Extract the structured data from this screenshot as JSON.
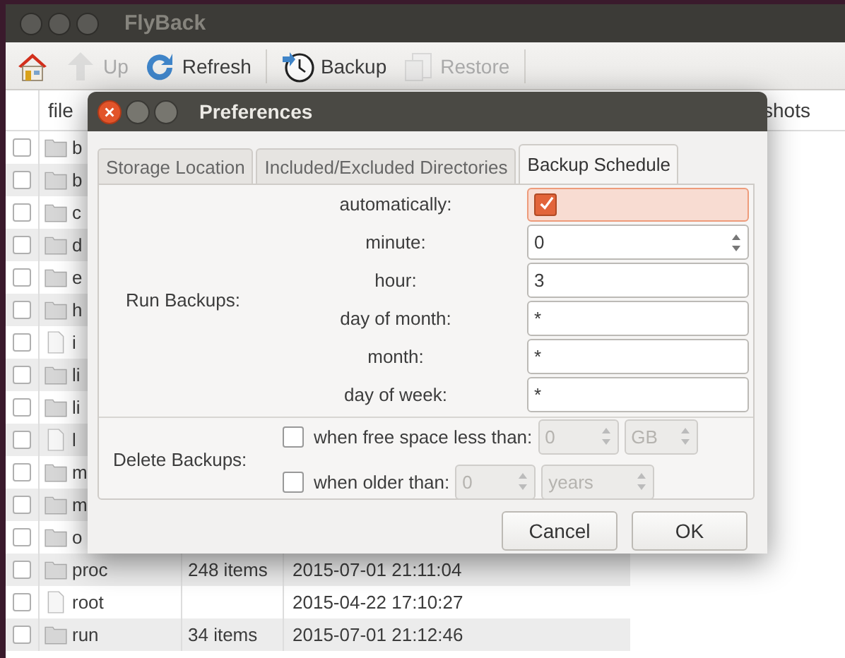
{
  "main_window": {
    "title": "FlyBack",
    "toolbar_groups": [
      {
        "items": [
          {
            "kind": "home",
            "disabled": false
          },
          {
            "kind": "up",
            "label": "Up",
            "disabled": true
          },
          {
            "kind": "refresh",
            "label": "Refresh",
            "disabled": false
          }
        ]
      },
      {
        "items": [
          {
            "kind": "backup",
            "label": "Backup",
            "disabled": false
          },
          {
            "kind": "restore",
            "label": "Restore",
            "disabled": true
          }
        ]
      }
    ],
    "table": {
      "columns": [
        "file",
        "shots"
      ],
      "rows": [
        {
          "kind": "folder",
          "checked": false,
          "name": "b"
        },
        {
          "kind": "folder",
          "checked": false,
          "name": "b"
        },
        {
          "kind": "folder",
          "checked": false,
          "name": "c"
        },
        {
          "kind": "folder",
          "checked": false,
          "name": "d"
        },
        {
          "kind": "folder",
          "checked": false,
          "name": "e"
        },
        {
          "kind": "folder",
          "checked": false,
          "name": "h"
        },
        {
          "kind": "file",
          "checked": false,
          "name": "i"
        },
        {
          "kind": "folder",
          "checked": false,
          "name": "li"
        },
        {
          "kind": "folder",
          "checked": false,
          "name": "li"
        },
        {
          "kind": "file",
          "checked": false,
          "name": "l"
        },
        {
          "kind": "folder",
          "checked": false,
          "name": "m"
        },
        {
          "kind": "folder",
          "checked": false,
          "name": "m"
        },
        {
          "kind": "folder",
          "checked": false,
          "name": "o"
        },
        {
          "kind": "folder",
          "checked": false,
          "name": "proc",
          "size": "248 items",
          "modified": "2015-07-01 21:11:04"
        },
        {
          "kind": "file",
          "checked": false,
          "name": "root",
          "modified": "2015-04-22 17:10:27"
        },
        {
          "kind": "folder",
          "checked": false,
          "name": "run",
          "size": "34 items",
          "modified": "2015-07-01 21:12:46"
        }
      ]
    }
  },
  "dialog": {
    "title": "Preferences",
    "tabs": [
      {
        "label": "Storage Location",
        "selected": false
      },
      {
        "label": "Included/Excluded Directories",
        "selected": false
      },
      {
        "label": "Backup Schedule",
        "selected": true
      }
    ],
    "run_backups": {
      "label": "Run Backups:",
      "rows": [
        {
          "kind": "checkbox",
          "label": "automatically:",
          "checked": true,
          "highlighted": true
        },
        {
          "kind": "spin",
          "label": "minute:",
          "value": "0"
        },
        {
          "kind": "text",
          "label": "hour:",
          "value": "3"
        },
        {
          "kind": "text",
          "label": "day of month:",
          "value": "*"
        },
        {
          "kind": "text",
          "label": "month:",
          "value": "*"
        },
        {
          "kind": "text",
          "label": "day of week:",
          "value": "*"
        }
      ]
    },
    "delete_backups": {
      "label": "Delete Backups:",
      "rows": [
        {
          "label": "when free space less than:",
          "checked": false,
          "disabled": true,
          "value": "0",
          "unit": "GB"
        },
        {
          "label": "when older than:",
          "checked": false,
          "disabled": true,
          "value": "0",
          "unit": "years"
        }
      ]
    },
    "buttons": [
      "Cancel",
      "OK"
    ]
  }
}
